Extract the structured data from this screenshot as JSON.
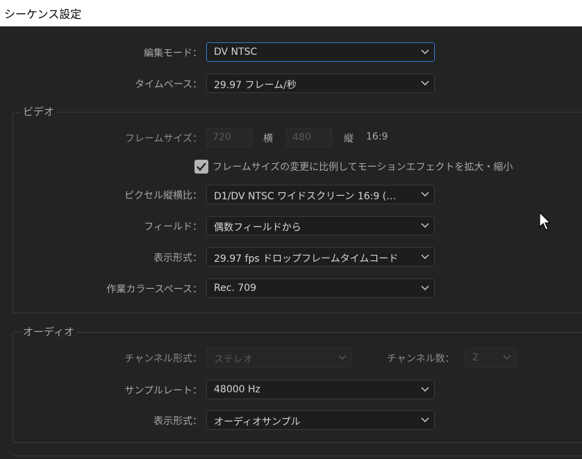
{
  "window": {
    "title": "シーケンス設定"
  },
  "editing_mode": {
    "label": "編集モード：",
    "value": "DV NTSC"
  },
  "timebase": {
    "label": "タイムベース：",
    "value": "29.97  フレーム/秒"
  },
  "video": {
    "legend": "ビデオ",
    "frame_size": {
      "label": "フレームサイズ：",
      "width_value": "720",
      "width_label": "横",
      "height_value": "480",
      "height_label": "縦",
      "ratio": "16:9"
    },
    "scale_checkbox": {
      "checked": true,
      "label": "フレームサイズの変更に比例してモーションエフェクトを拡大・縮小"
    },
    "pixel_aspect": {
      "label": "ピクセル縦横比：",
      "value": "D1/DV  NTSC ワイドスクリーン 16:9 (…"
    },
    "fields": {
      "label": "フィールド：",
      "value": "偶数フィールドから"
    },
    "display_format": {
      "label": "表示形式：",
      "value": "29.97  fps  ドロップフレームタイムコード"
    },
    "color_space": {
      "label": "作業カラースペース：",
      "value": "Rec. 709"
    }
  },
  "audio": {
    "legend": "オーディオ",
    "channel_format": {
      "label": "チャンネル形式：",
      "value": "ステレオ"
    },
    "channel_count": {
      "label": "チャンネル数：",
      "value": "2"
    },
    "sample_rate": {
      "label": "サンプルレート：",
      "value": "48000 Hz"
    },
    "display_format": {
      "label": "表示形式：",
      "value": "オーディオサンプル"
    }
  },
  "icons": {
    "dropdown": "chevron-down-icon",
    "checkbox": "checkmark-icon",
    "cursor": "mouse-pointer-icon"
  },
  "colors": {
    "background": "#232323",
    "field_background": "#1d1d1d",
    "focus_border": "#2f7fd6",
    "title_bar": "#ffffff"
  }
}
